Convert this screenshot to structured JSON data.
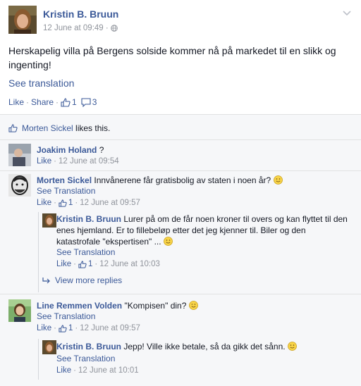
{
  "post": {
    "author": "Kristin B. Bruun",
    "timestamp": "12 June at 09:49",
    "privacy_icon": "globe-icon",
    "text": "Herskapelig villa på Bergens solside kommer nå på markedet til en slikk og ingenting!",
    "see_translation": "See translation",
    "like_label": "Like",
    "share_label": "Share",
    "like_count": "1",
    "comment_count": "3"
  },
  "likes": {
    "name": "Morten Sickel",
    "suffix": "likes this."
  },
  "comments": [
    {
      "author": "Joakim Holand",
      "text": "?",
      "like_label": "Like",
      "timestamp": "12 June at 09:54"
    },
    {
      "author": "Morten Sickel",
      "text": "Innvånerene får gratisbolig av staten i noen år?",
      "see_translation": "See Translation",
      "like_label": "Like",
      "like_count": "1",
      "timestamp": "12 June at 09:57",
      "reply": {
        "author": "Kristin B. Bruun",
        "text": "Lurer på om de får noen kroner til overs og kan flyttet til den enes hjemland. Er to fillebeløp etter det jeg kjenner til. Biler og den katastrofale \"ekspertisen\" ...",
        "see_translation": "See Translation",
        "like_label": "Like",
        "like_count": "1",
        "timestamp": "12 June at 10:03"
      },
      "view_more": "View more replies"
    },
    {
      "author": "Line Remmen Volden",
      "text": "\"Kompisen\" din?",
      "see_translation": "See Translation",
      "like_label": "Like",
      "like_count": "1",
      "timestamp": "12 June at 09:57",
      "reply": {
        "author": "Kristin B. Bruun",
        "text": "Jepp! Ville ikke betale, så da gikk det sånn.",
        "see_translation": "See Translation",
        "like_label": "Like",
        "timestamp": "12 June at 10:01"
      }
    }
  ],
  "colors": {
    "link": "#3b5998",
    "meta": "#90949c",
    "comments_bg": "#f6f7f9",
    "border": "#e1e2e3"
  }
}
